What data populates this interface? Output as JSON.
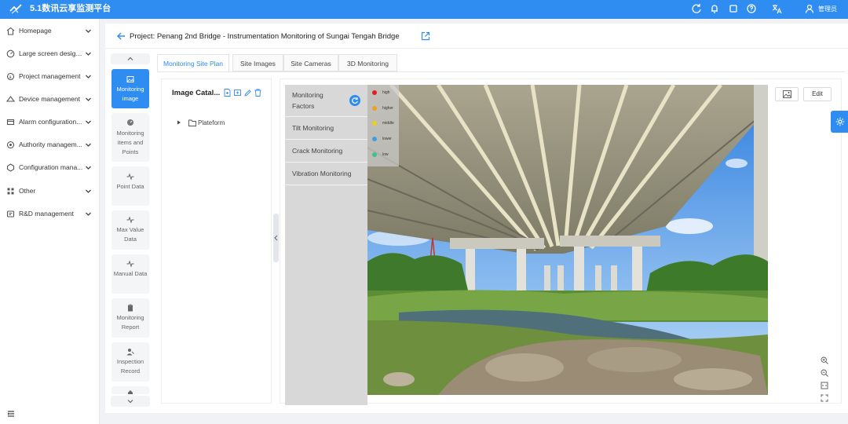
{
  "app": {
    "title": "5.1数讯云享监测平台",
    "user_name": "管理员",
    "header_icons": [
      "refresh-icon",
      "bell-icon",
      "screen-icon",
      "help-icon",
      "translate-icon",
      "user-icon"
    ]
  },
  "sidebar": {
    "items": [
      {
        "label": "Homepage",
        "icon": "home-icon"
      },
      {
        "label": "Large screen design...",
        "icon": "dashboard-icon"
      },
      {
        "label": "Project management",
        "icon": "project-icon"
      },
      {
        "label": "Device management",
        "icon": "device-icon"
      },
      {
        "label": "Alarm configuration...",
        "icon": "alarm-icon"
      },
      {
        "label": "Authority managem...",
        "icon": "authority-icon"
      },
      {
        "label": "Configuration mana...",
        "icon": "config-icon"
      },
      {
        "label": "Other",
        "icon": "grid-icon"
      },
      {
        "label": "R&D management",
        "icon": "rnd-icon"
      }
    ]
  },
  "project": {
    "title": "Project: Penang 2nd Bridge - Instrumentation Monitoring of Sungai Tengah Bridge"
  },
  "functions": [
    {
      "label": "Monitoring image",
      "icon": "image-icon",
      "active": true
    },
    {
      "label": "Monitoring items and Points",
      "icon": "gauge-icon",
      "active": false
    },
    {
      "label": "Point Data",
      "icon": "pulse-icon",
      "active": false
    },
    {
      "label": "Max Value Data",
      "icon": "pulse-icon",
      "active": false
    },
    {
      "label": "Manual Data",
      "icon": "pulse-icon",
      "active": false
    },
    {
      "label": "Monitoring Report",
      "icon": "clipboard-icon",
      "active": false
    },
    {
      "label": "Inspection Record",
      "icon": "inspector-icon",
      "active": false
    }
  ],
  "tabs": [
    {
      "label": "Monitoring Site Plan",
      "active": true
    },
    {
      "label": "Site Images",
      "active": false
    },
    {
      "label": "Site Cameras",
      "active": false
    },
    {
      "label": "3D Monitoring",
      "active": false
    }
  ],
  "catalog": {
    "title": "Image Catal...",
    "tree": [
      {
        "label": "Plateform",
        "expanded": false
      }
    ]
  },
  "factors": {
    "title": "Monitoring Factors",
    "items": [
      "Tilt Monitoring",
      "Crack Monitoring",
      "Vibration Monitoring"
    ]
  },
  "legend": [
    {
      "label": "high",
      "color": "#e02020"
    },
    {
      "label": "higher",
      "color": "#f0a020"
    },
    {
      "label": "middle",
      "color": "#e8d020"
    },
    {
      "label": "lower",
      "color": "#3aa0e0"
    },
    {
      "label": "low",
      "color": "#40c090"
    }
  ],
  "viewer": {
    "edit_label": "Edit",
    "zoom_icons": [
      "zoom-in-icon",
      "zoom-out-icon",
      "fit-icon",
      "fullscreen-icon"
    ]
  },
  "colors": {
    "primary": "#2f8cf0",
    "factor_panel": "#d8d8d8"
  }
}
